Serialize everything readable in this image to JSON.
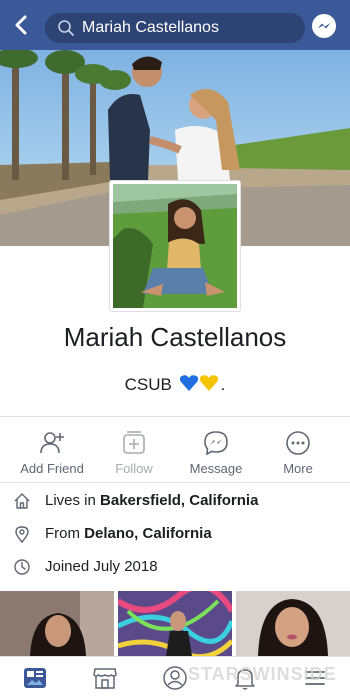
{
  "header": {
    "search_value": "Mariah Castellanos"
  },
  "profile": {
    "name": "Mariah Castellanos",
    "bio": "CSUB",
    "bio_suffix": "."
  },
  "actions": [
    {
      "label": "Add Friend",
      "icon": "add-friend-icon"
    },
    {
      "label": "Follow",
      "icon": "follow-icon",
      "disabled": true
    },
    {
      "label": "Message",
      "icon": "messenger-icon"
    },
    {
      "label": "More",
      "icon": "more-icon"
    }
  ],
  "intro": {
    "lives_prefix": "Lives in ",
    "lives_value": "Bakersfield, California",
    "from_prefix": "From ",
    "from_value": "Delano, California",
    "joined": "Joined July 2018"
  },
  "watermark": "STARSWINSIDE",
  "colors": {
    "brand": "#3b5998",
    "heart_blue": "#1f6fe0",
    "heart_yellow": "#f5c400"
  }
}
